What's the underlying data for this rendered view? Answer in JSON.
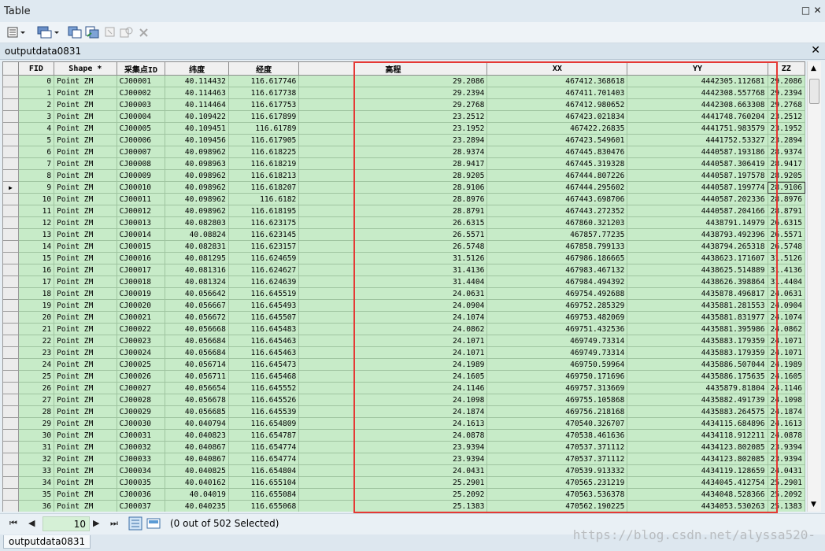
{
  "window": {
    "title": "Table"
  },
  "tab": {
    "title": "outputdata0831"
  },
  "table": {
    "columns": [
      "FID",
      "Shape *",
      "采集点ID",
      "纬度",
      "经度",
      "高程",
      "XX",
      "YY",
      "ZZ"
    ],
    "current_row_indicator": "▶",
    "current_row_index": 9,
    "rows": [
      [
        "0",
        "Point ZM",
        "CJ00001",
        "40.114432",
        "116.617746",
        "29.2086",
        "467412.368618",
        "4442305.112681",
        "29.2086"
      ],
      [
        "1",
        "Point ZM",
        "CJ00002",
        "40.114463",
        "116.617738",
        "29.2394",
        "467411.701403",
        "4442308.557768",
        "29.2394"
      ],
      [
        "2",
        "Point ZM",
        "CJ00003",
        "40.114464",
        "116.617753",
        "29.2768",
        "467412.980652",
        "4442308.663308",
        "29.2768"
      ],
      [
        "3",
        "Point ZM",
        "CJ00004",
        "40.109422",
        "116.617899",
        "23.2512",
        "467423.021834",
        "4441748.760204",
        "23.2512"
      ],
      [
        "4",
        "Point ZM",
        "CJ00005",
        "40.109451",
        "116.61789",
        "23.1952",
        "467422.26835",
        "4441751.983579",
        "23.1952"
      ],
      [
        "5",
        "Point ZM",
        "CJ00006",
        "40.109456",
        "116.617905",
        "23.2894",
        "467423.549601",
        "4441752.53327",
        "23.2894"
      ],
      [
        "6",
        "Point ZM",
        "CJ00007",
        "40.098962",
        "116.618225",
        "28.9374",
        "467445.830476",
        "4440587.193186",
        "28.9374"
      ],
      [
        "7",
        "Point ZM",
        "CJ00008",
        "40.098963",
        "116.618219",
        "28.9417",
        "467445.319328",
        "4440587.306419",
        "28.9417"
      ],
      [
        "8",
        "Point ZM",
        "CJ00009",
        "40.098962",
        "116.618213",
        "28.9205",
        "467444.807226",
        "4440587.197578",
        "28.9205"
      ],
      [
        "9",
        "Point ZM",
        "CJ00010",
        "40.098962",
        "116.618207",
        "28.9106",
        "467444.295602",
        "4440587.199774",
        "28.9106"
      ],
      [
        "10",
        "Point ZM",
        "CJ00011",
        "40.098962",
        "116.6182",
        "28.8976",
        "467443.698706",
        "4440587.202336",
        "28.8976"
      ],
      [
        "11",
        "Point ZM",
        "CJ00012",
        "40.098962",
        "116.618195",
        "28.8791",
        "467443.272352",
        "4440587.204166",
        "28.8791"
      ],
      [
        "12",
        "Point ZM",
        "CJ00013",
        "40.082803",
        "116.623175",
        "26.6315",
        "467860.321203",
        "4438791.14979",
        "26.6315"
      ],
      [
        "13",
        "Point ZM",
        "CJ00014",
        "40.08824",
        "116.623145",
        "26.5571",
        "467857.77235",
        "4438793.492396",
        "26.5571"
      ],
      [
        "14",
        "Point ZM",
        "CJ00015",
        "40.082831",
        "116.623157",
        "26.5748",
        "467858.799133",
        "4438794.265318",
        "26.5748"
      ],
      [
        "15",
        "Point ZM",
        "CJ00016",
        "40.081295",
        "116.624659",
        "31.5126",
        "467986.186665",
        "4438623.171607",
        "31.5126"
      ],
      [
        "16",
        "Point ZM",
        "CJ00017",
        "40.081316",
        "116.624627",
        "31.4136",
        "467983.467132",
        "4438625.514889",
        "31.4136"
      ],
      [
        "17",
        "Point ZM",
        "CJ00018",
        "40.081324",
        "116.624639",
        "31.4404",
        "467984.494392",
        "4438626.398864",
        "31.4404"
      ],
      [
        "18",
        "Point ZM",
        "CJ00019",
        "40.056642",
        "116.645519",
        "24.0631",
        "469754.492688",
        "4435878.496817",
        "24.0631"
      ],
      [
        "19",
        "Point ZM",
        "CJ00020",
        "40.056667",
        "116.645493",
        "24.0904",
        "469752.285329",
        "4435881.281553",
        "24.0904"
      ],
      [
        "20",
        "Point ZM",
        "CJ00021",
        "40.056672",
        "116.645507",
        "24.1074",
        "469753.482069",
        "4435881.831977",
        "24.1074"
      ],
      [
        "21",
        "Point ZM",
        "CJ00022",
        "40.056668",
        "116.645483",
        "24.0862",
        "469751.432536",
        "4435881.395986",
        "24.0862"
      ],
      [
        "22",
        "Point ZM",
        "CJ00023",
        "40.056684",
        "116.645463",
        "24.1071",
        "469749.73314",
        "4435883.179359",
        "24.1071"
      ],
      [
        "23",
        "Point ZM",
        "CJ00024",
        "40.056684",
        "116.645463",
        "24.1071",
        "469749.73314",
        "4435883.179359",
        "24.1071"
      ],
      [
        "24",
        "Point ZM",
        "CJ00025",
        "40.056714",
        "116.645473",
        "24.1989",
        "469750.59964",
        "4435886.507044",
        "24.1989"
      ],
      [
        "25",
        "Point ZM",
        "CJ00026",
        "40.056711",
        "116.645468",
        "24.1605",
        "469750.171696",
        "4435886.175635",
        "24.1605"
      ],
      [
        "26",
        "Point ZM",
        "CJ00027",
        "40.056654",
        "116.645552",
        "24.1146",
        "469757.313669",
        "4435879.81804",
        "24.1146"
      ],
      [
        "27",
        "Point ZM",
        "CJ00028",
        "40.056678",
        "116.645526",
        "24.1098",
        "469755.105868",
        "4435882.491739",
        "24.1098"
      ],
      [
        "28",
        "Point ZM",
        "CJ00029",
        "40.056685",
        "116.645539",
        "24.1874",
        "469756.218168",
        "4435883.264575",
        "24.1874"
      ],
      [
        "29",
        "Point ZM",
        "CJ00030",
        "40.040794",
        "116.654809",
        "24.1613",
        "470540.326707",
        "4434115.684896",
        "24.1613"
      ],
      [
        "30",
        "Point ZM",
        "CJ00031",
        "40.040823",
        "116.654787",
        "24.0878",
        "470538.461636",
        "4434118.912211",
        "24.0878"
      ],
      [
        "31",
        "Point ZM",
        "CJ00032",
        "40.040867",
        "116.654774",
        "23.9394",
        "470537.371112",
        "4434123.802085",
        "23.9394"
      ],
      [
        "32",
        "Point ZM",
        "CJ00033",
        "40.040867",
        "116.654774",
        "23.9394",
        "470537.371112",
        "4434123.802085",
        "23.9394"
      ],
      [
        "33",
        "Point ZM",
        "CJ00034",
        "40.040825",
        "116.654804",
        "24.0431",
        "470539.913332",
        "4434119.128659",
        "24.0431"
      ],
      [
        "34",
        "Point ZM",
        "CJ00035",
        "40.040162",
        "116.655104",
        "25.2901",
        "470565.231219",
        "4434045.412754",
        "25.2901"
      ],
      [
        "35",
        "Point ZM",
        "CJ00036",
        "40.04019",
        "116.655084",
        "25.2092",
        "470563.536378",
        "4434048.528366",
        "25.2092"
      ],
      [
        "36",
        "Point ZM",
        "CJ00037",
        "40.040235",
        "116.655068",
        "25.1383",
        "470562.190225",
        "4434053.530263",
        "25.1383"
      ]
    ]
  },
  "status": {
    "page_value": "10",
    "selection_text": "(0 out of 502 Selected)"
  },
  "bottom_tab": {
    "label": "outputdata0831"
  },
  "watermark": "https://blog.csdn.net/alyssa520-"
}
